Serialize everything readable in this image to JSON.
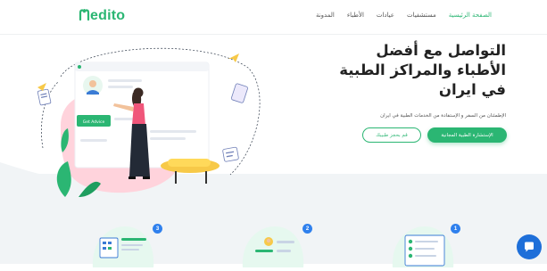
{
  "brand": {
    "logo_text": "edito",
    "accent": "#2bb673",
    "badge_color": "#2f80ed"
  },
  "nav": {
    "items": [
      {
        "label": "الصفحة الرئيسية",
        "active": true
      },
      {
        "label": "مستشفيات",
        "active": false
      },
      {
        "label": "عيادات",
        "active": false
      },
      {
        "label": "الأطباء",
        "active": false
      },
      {
        "label": "المدونة",
        "active": false
      }
    ]
  },
  "hero": {
    "headline_line1": "التواصل مع أفضل",
    "headline_line2": "الأطباء والمراكز الطبية",
    "headline_line3": "في ايران",
    "subtext": "الإطمئنان من السفر و الإستفادة من الخدمات الطبية في ايران",
    "primary_button": "الإستشارة الطبية المجانية",
    "secondary_button": "قم بحجز طبيبك",
    "illustration_button": "Get Advice"
  },
  "steps": [
    {
      "number": "1"
    },
    {
      "number": "2"
    },
    {
      "number": "3"
    }
  ],
  "chat": {
    "icon": "chat-bubble-icon"
  }
}
